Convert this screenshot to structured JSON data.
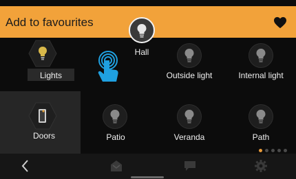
{
  "header": {
    "title": "Add to favourites",
    "favourite_icon": "heart-icon",
    "accent_color": "#f2a23a"
  },
  "dragging_item": {
    "label": "Hall",
    "icon": "bulb-icon"
  },
  "sidebar": {
    "items": [
      {
        "label": "Lights",
        "icon": "bulb-icon",
        "selected": true
      },
      {
        "label": "Doors",
        "icon": "door-icon",
        "selected": false
      }
    ]
  },
  "devices": [
    {
      "label": "Outside light",
      "icon": "bulb-icon"
    },
    {
      "label": "Internal light",
      "icon": "bulb-icon"
    },
    {
      "label": "Patio",
      "icon": "bulb-icon"
    },
    {
      "label": "Veranda",
      "icon": "bulb-icon"
    },
    {
      "label": "Path",
      "icon": "bulb-icon"
    }
  ],
  "pagination": {
    "pages": 5,
    "current": 1
  },
  "footer": {
    "buttons": [
      {
        "name": "back",
        "icon": "chevron-left-icon"
      },
      {
        "name": "home",
        "icon": "home-icon"
      },
      {
        "name": "messages",
        "icon": "chat-icon"
      },
      {
        "name": "settings",
        "icon": "gear-icon"
      }
    ]
  }
}
